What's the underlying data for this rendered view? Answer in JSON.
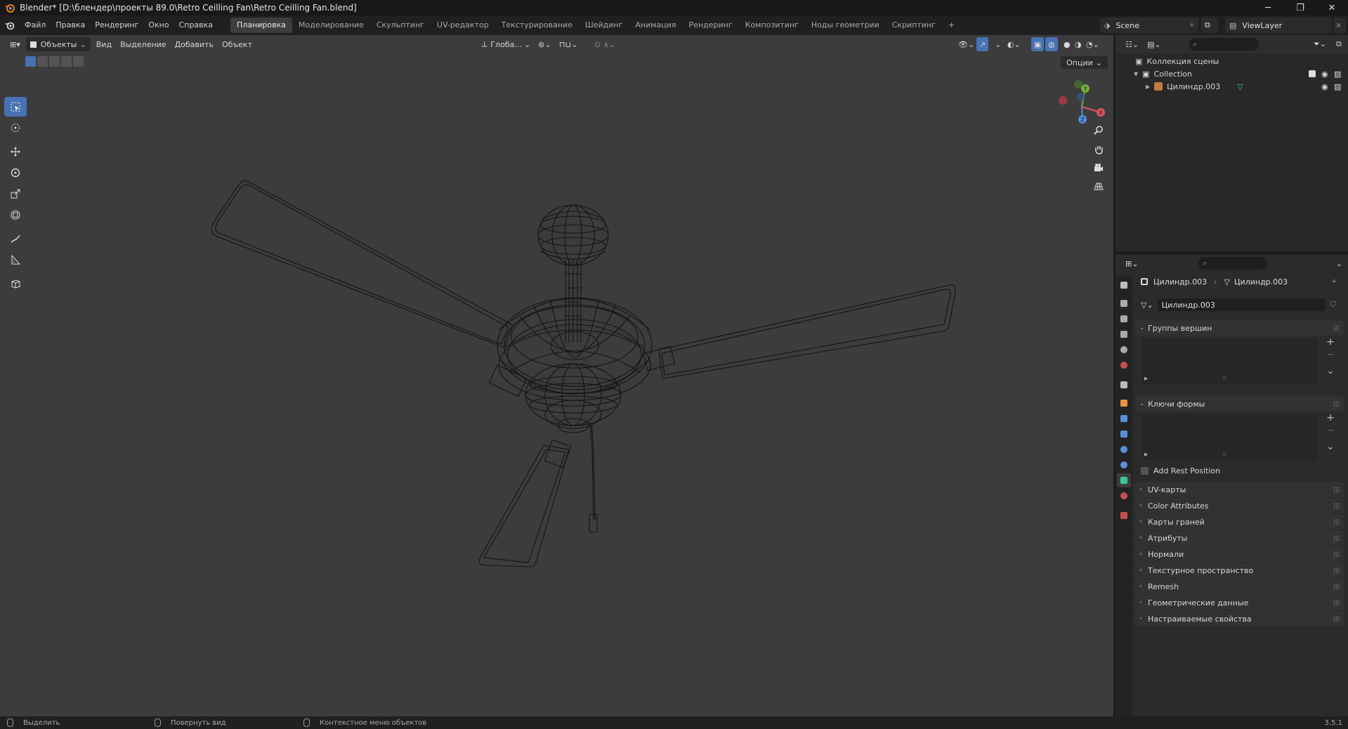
{
  "window": {
    "title": "Blender* [D:\\блендер\\проекты 89.0\\Retro Ceilling Fan\\Retro Ceilling Fan.blend]"
  },
  "menu": [
    "Файл",
    "Правка",
    "Рендеринг",
    "Окно",
    "Справка"
  ],
  "workspaces": [
    "Планировка",
    "Моделирование",
    "Скульптинг",
    "UV-редактор",
    "Текстурирование",
    "Шейдинг",
    "Анимация",
    "Рендеринг",
    "Композитинг",
    "Ноды геометрии",
    "Скриптинг"
  ],
  "active_workspace": "Планировка",
  "scene": {
    "name": "Scene",
    "view_layer": "ViewLayer"
  },
  "viewport": {
    "mode": "Объекты",
    "menus": [
      "Вид",
      "Выделение",
      "Добавить",
      "Объект"
    ],
    "orientation": "Глоба...",
    "options_label": "Опции",
    "tools": [
      "select-box-tool",
      "cursor-tool",
      "move-tool",
      "rotate-tool",
      "scale-tool",
      "transform-tool",
      "annotate-tool",
      "measure-tool",
      "add-cube-tool"
    ],
    "gizmo": {
      "x_label": "X",
      "y_label": "Y",
      "z_label": "Z",
      "x_color": "#e05060",
      "y_color": "#70b040",
      "z_color": "#4f8ee0"
    }
  },
  "outliner": {
    "root": "Коллекция сцены",
    "collection": "Collection",
    "object": "Цилиндр.003"
  },
  "properties": {
    "breadcrumb_object": "Цилиндр.003",
    "breadcrumb_mesh": "Цилиндр.003",
    "mesh_name": "Цилиндр.003",
    "panels_open": [
      {
        "id": "vertex-groups",
        "label": "Группы вершин"
      },
      {
        "id": "shape-keys",
        "label": "Ключи формы"
      }
    ],
    "add_rest_position": "Add Rest Position",
    "panels_closed": [
      "UV-карты",
      "Color Attributes",
      "Карты граней",
      "Атрибуты",
      "Нормали",
      "Текстурное пространство",
      "Remesh",
      "Геометрические данные",
      "Настраиваемые свойства"
    ]
  },
  "status": {
    "left": "Выделить",
    "middle": "Повернуть вид",
    "right": "Контекстное меню объектов",
    "version": "3.5.1"
  },
  "colors": {
    "accent": "#4772b3",
    "mesh_data_icon": "#3fc79a"
  }
}
